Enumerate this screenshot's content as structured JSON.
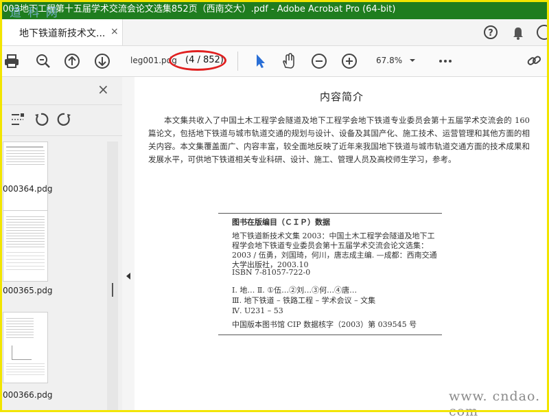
{
  "window": {
    "title": "003地下工程第十五届学术交流会论文选集852页（西南交大）.pdf - Adobe Acrobat Pro (64-bit)"
  },
  "watermark_top": "道 科 网",
  "watermark_bottom": "www. cndao. com",
  "tab": {
    "label": "地下铁道新技术文...",
    "close": "×"
  },
  "toolbar": {
    "file_name": "leg001.pdg",
    "page_indicator": "(4 / 852)",
    "zoom": "67.8%"
  },
  "sidebar": {
    "close": "×",
    "thumbnails": [
      {
        "label": "000364.pdg"
      },
      {
        "label": "000365.pdg"
      },
      {
        "label": "000366.pdg"
      }
    ]
  },
  "document": {
    "heading": "内容简介",
    "intro": "本文集共收入了中国土木工程学会隧道及地下工程学会地下铁道专业委员会第十五届学术交流会的 160 篇论文，包括地下铁道与城市轨道交通的规划与设计、设备及其国产化、施工技术、运营管理和其他方面的相关内容。本文集覆盖面广、内容丰富，较全面地反映了近年来我国地下铁道与城市轨道交通方面的技术成果和发展水平，可供地下铁道相关专业科研、设计、施工、管理人员及高校师生学习，参考。",
    "cip_heading": "图书在版编目（ＣＩＰ）数据",
    "cip_body": "地下铁道新技术文集 2003：中国土木工程学会隧道及地下工程学会地下铁道专业委员会第十五届学术交流会论文选集：2003 / 伍勇，刘国琦，何川，唐志成主编. —成都：西南交通大学出版社，2003.10",
    "isbn": "ISBN 7-81057-722-0",
    "class_1": "Ⅰ. 地… Ⅱ. ①伍…②刘…③何…④唐…",
    "class_2": "Ⅲ. 地下铁道 – 铁路工程 – 学术会议 – 文集",
    "class_3": "Ⅳ. U231 – 53",
    "cip_number": "中国版本图书馆 CIP 数据核字（2003）第 039545 号"
  }
}
